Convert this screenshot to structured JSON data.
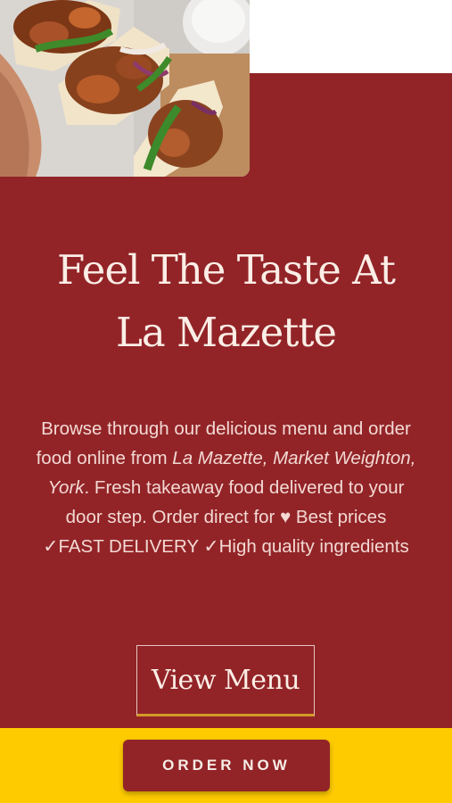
{
  "hero": {
    "image_alt": "chicken wraps",
    "headline_line1": "Feel The Taste At",
    "headline_line2": "La Mazette",
    "description": {
      "text1": "Browse through our delicious menu and order food online from ",
      "italic": "La Mazette, Market Weighton, York",
      "text2": ". Fresh takeaway food delivered to your door step. Order direct for ",
      "heart_glyph": "♥",
      "text3": " Best prices ",
      "check1": "✓",
      "text4": "FAST DELIVERY ",
      "check2": "✓",
      "text5": "High quality ingredients"
    },
    "view_menu_label": "View Menu"
  },
  "order_bar": {
    "order_now_label": "ORDER NOW"
  },
  "colors": {
    "brand_red": "#922428",
    "accent_yellow": "#fecb00",
    "underline_gold": "#d49a26"
  }
}
